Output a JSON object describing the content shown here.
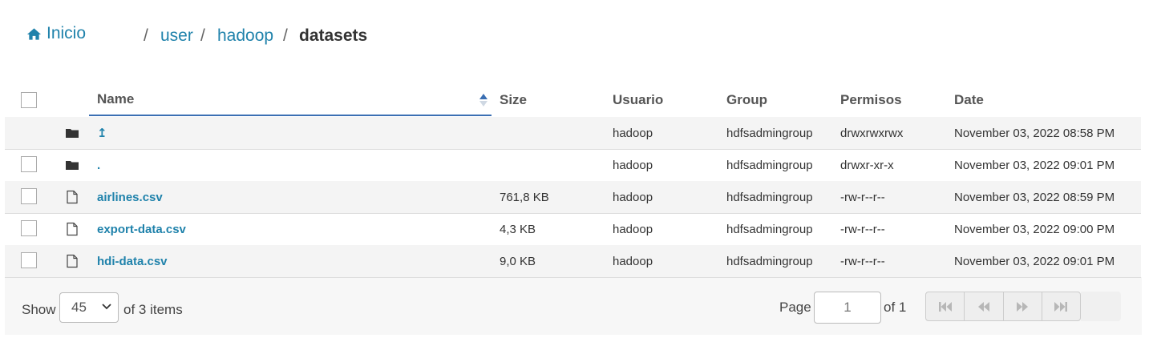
{
  "breadcrumb": {
    "home_label": "Inicio",
    "separator": "/",
    "items": [
      "user",
      "hadoop"
    ],
    "current": "datasets"
  },
  "table": {
    "columns": {
      "name": "Name",
      "size": "Size",
      "user": "Usuario",
      "group": "Group",
      "perms": "Permisos",
      "date": "Date"
    },
    "rows": [
      {
        "icon": "folder-icon",
        "name": "↥",
        "size": "",
        "user": "hadoop",
        "group": "hdfsadmingroup",
        "perms": "drwxrwxrwx",
        "date": "November 03, 2022 08:58 PM"
      },
      {
        "icon": "folder-icon",
        "name": ".",
        "size": "",
        "user": "hadoop",
        "group": "hdfsadmingroup",
        "perms": "drwxr-xr-x",
        "date": "November 03, 2022 09:01 PM"
      },
      {
        "icon": "file-icon",
        "name": "airlines.csv",
        "size": "761,8 KB",
        "user": "hadoop",
        "group": "hdfsadmingroup",
        "perms": "-rw-r--r--",
        "date": "November 03, 2022 08:59 PM"
      },
      {
        "icon": "file-icon",
        "name": "export-data.csv",
        "size": "4,3 KB",
        "user": "hadoop",
        "group": "hdfsadmingroup",
        "perms": "-rw-r--r--",
        "date": "November 03, 2022 09:00 PM"
      },
      {
        "icon": "file-icon",
        "name": "hdi-data.csv",
        "size": "9,0 KB",
        "user": "hadoop",
        "group": "hdfsadmingroup",
        "perms": "-rw-r--r--",
        "date": "November 03, 2022 09:01 PM"
      }
    ]
  },
  "footer": {
    "show_label": "Show",
    "page_size": "45",
    "items_label": "of 3 items",
    "page_label": "Page",
    "page_value": "1",
    "of_pages": "of 1"
  },
  "colors": {
    "link": "#1f82ab",
    "sort_active": "#3b6fb3"
  }
}
